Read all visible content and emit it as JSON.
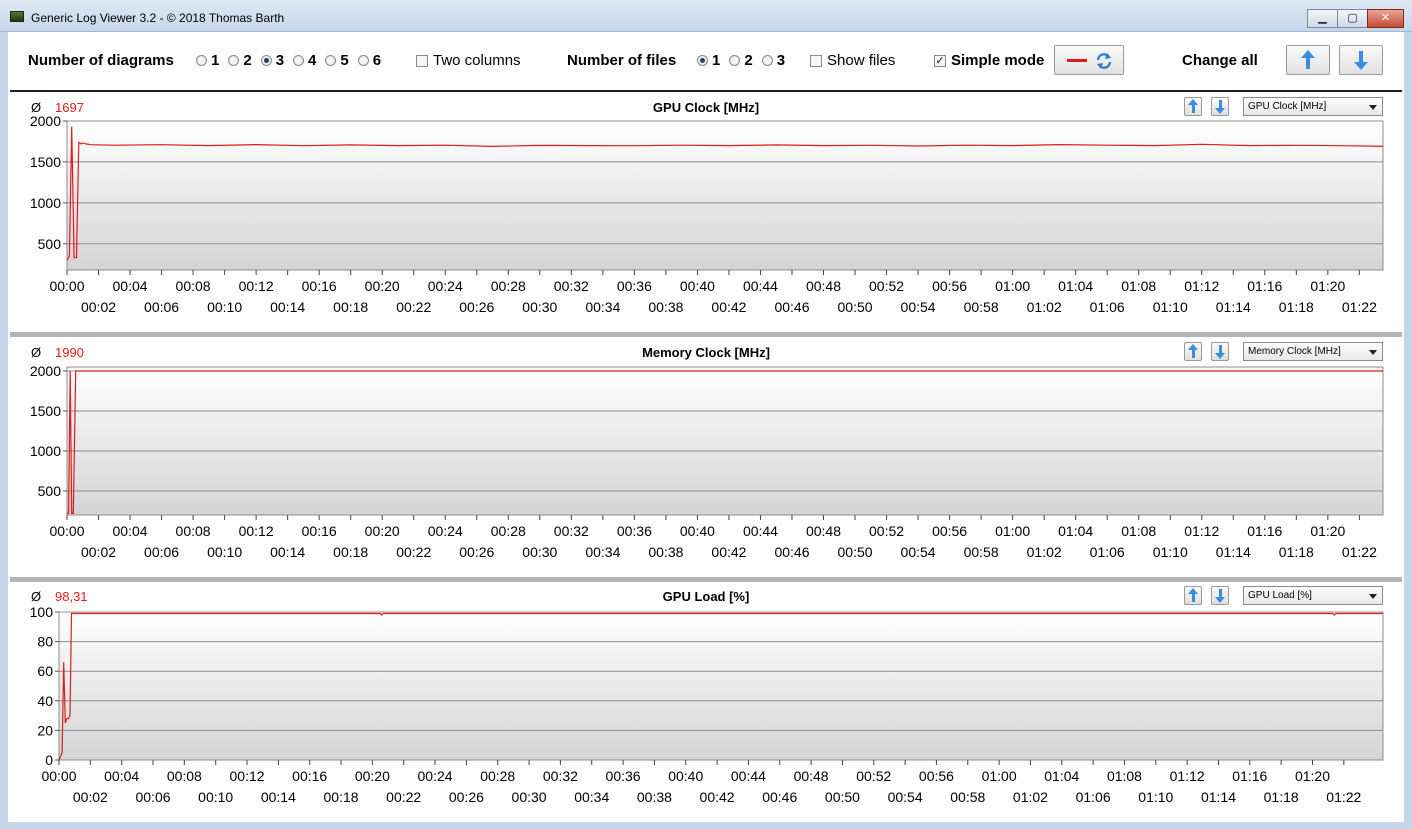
{
  "window": {
    "title": "Generic Log Viewer 3.2 - © 2018 Thomas Barth",
    "minimize": "▁",
    "maximize": "▢",
    "close": "✕"
  },
  "toolbar": {
    "diagrams_label": "Number of diagrams",
    "diagram_options": [
      "1",
      "2",
      "3",
      "4",
      "5",
      "6"
    ],
    "diagrams_selected": "3",
    "two_columns_label": "Two columns",
    "two_columns_checked": false,
    "files_label": "Number of files",
    "file_options": [
      "1",
      "2",
      "3"
    ],
    "files_selected": "1",
    "show_files_label": "Show files",
    "show_files_checked": false,
    "simple_mode_label": "Simple mode",
    "simple_mode_checked": true,
    "change_all_label": "Change all",
    "line_color": "#e21b1b",
    "icons": [
      "red-line-icon",
      "refresh-icon",
      "arrow-up-icon",
      "arrow-down-icon"
    ]
  },
  "panels": [
    {
      "average_symbol": "Ø",
      "average_value": "1697",
      "title": "GPU Clock [MHz]",
      "select_value": "GPU Clock [MHz]"
    },
    {
      "average_symbol": "Ø",
      "average_value": "1990",
      "title": "Memory Clock [MHz]",
      "select_value": "Memory Clock [MHz]"
    },
    {
      "average_symbol": "Ø",
      "average_value": "98,31",
      "title": "GPU Load [%]",
      "select_value": "GPU Load [%]"
    }
  ],
  "chart_data": [
    {
      "type": "line",
      "title": "GPU Clock [MHz]",
      "x_unit": "minutes",
      "xlim": [
        0,
        83.5
      ],
      "ylim": [
        180,
        2000
      ],
      "yticks": [
        500,
        1000,
        1500,
        2000
      ],
      "xticks_top": [
        "00:00",
        "00:04",
        "00:08",
        "00:12",
        "00:16",
        "00:20",
        "00:24",
        "00:28",
        "00:32",
        "00:36",
        "00:40",
        "00:44",
        "00:48",
        "00:52",
        "00:56",
        "01:00",
        "01:04",
        "01:08",
        "01:12",
        "01:16",
        "01:20"
      ],
      "xticks_bottom": [
        "00:02",
        "00:06",
        "00:10",
        "00:14",
        "00:18",
        "00:22",
        "00:26",
        "00:30",
        "00:34",
        "00:38",
        "00:42",
        "00:46",
        "00:50",
        "00:54",
        "00:58",
        "01:02",
        "01:06",
        "01:10",
        "01:14",
        "01:18",
        "01:22"
      ],
      "series": [
        {
          "color": "#e21b1b",
          "x": [
            0,
            0.15,
            0.3,
            0.45,
            0.6,
            0.75,
            0.9,
            1.0,
            1.2,
            1.5,
            3,
            6,
            9,
            12,
            15,
            18,
            21,
            24,
            27,
            30,
            33,
            36,
            39,
            42,
            45,
            48,
            51,
            54,
            57,
            60,
            63,
            66,
            69,
            72,
            75,
            78,
            81,
            83.5
          ],
          "y": [
            300,
            350,
            1930,
            330,
            330,
            1740,
            1720,
            1730,
            1720,
            1710,
            1705,
            1710,
            1700,
            1712,
            1698,
            1708,
            1700,
            1705,
            1690,
            1702,
            1700,
            1698,
            1705,
            1700,
            1708,
            1700,
            1703,
            1695,
            1705,
            1700,
            1712,
            1705,
            1700,
            1715,
            1700,
            1703,
            1698,
            1690
          ]
        }
      ]
    },
    {
      "type": "line",
      "title": "Memory Clock [MHz]",
      "x_unit": "minutes",
      "xlim": [
        0,
        83.5
      ],
      "ylim": [
        200,
        2050
      ],
      "yticks": [
        500,
        1000,
        1500,
        2000
      ],
      "xticks_top": [
        "00:00",
        "00:04",
        "00:08",
        "00:12",
        "00:16",
        "00:20",
        "00:24",
        "00:28",
        "00:32",
        "00:36",
        "00:40",
        "00:44",
        "00:48",
        "00:52",
        "00:56",
        "01:00",
        "01:04",
        "01:08",
        "01:12",
        "01:16",
        "01:20"
      ],
      "xticks_bottom": [
        "00:02",
        "00:06",
        "00:10",
        "00:14",
        "00:18",
        "00:22",
        "00:26",
        "00:30",
        "00:34",
        "00:38",
        "00:42",
        "00:46",
        "00:50",
        "00:54",
        "00:58",
        "01:02",
        "01:06",
        "01:10",
        "01:14",
        "01:18",
        "01:22"
      ],
      "series": [
        {
          "color": "#e21b1b",
          "x": [
            0,
            0.1,
            0.2,
            0.3,
            0.4,
            0.55,
            0.7,
            0.9,
            83.5
          ],
          "y": [
            220,
            220,
            2000,
            220,
            220,
            2000,
            2000,
            2000,
            2000
          ]
        }
      ]
    },
    {
      "type": "line",
      "title": "GPU Load [%]",
      "x_unit": "minutes",
      "xlim": [
        0,
        84.5
      ],
      "ylim": [
        0,
        100
      ],
      "yticks": [
        0,
        20,
        40,
        60,
        80,
        100
      ],
      "xticks_top": [
        "00:00",
        "00:04",
        "00:08",
        "00:12",
        "00:16",
        "00:20",
        "00:24",
        "00:28",
        "00:32",
        "00:36",
        "00:40",
        "00:44",
        "00:48",
        "00:52",
        "00:56",
        "01:00",
        "01:04",
        "01:08",
        "01:12",
        "01:16",
        "01:20"
      ],
      "xticks_bottom": [
        "00:02",
        "00:06",
        "00:10",
        "00:14",
        "00:18",
        "00:22",
        "00:26",
        "00:30",
        "00:34",
        "00:38",
        "00:42",
        "00:46",
        "00:50",
        "00:54",
        "00:58",
        "01:02",
        "01:06",
        "01:10",
        "01:14",
        "01:18",
        "01:22"
      ],
      "series": [
        {
          "color": "#e21b1b",
          "x": [
            0,
            0.2,
            0.3,
            0.4,
            0.5,
            0.6,
            0.7,
            0.8,
            1.0,
            20.5,
            20.6,
            20.7,
            81.3,
            81.4,
            81.5,
            84.5
          ],
          "y": [
            0,
            5,
            66,
            25,
            28,
            28,
            30,
            99,
            99,
            99,
            98,
            99,
            99,
            98,
            99,
            99
          ]
        }
      ]
    }
  ]
}
